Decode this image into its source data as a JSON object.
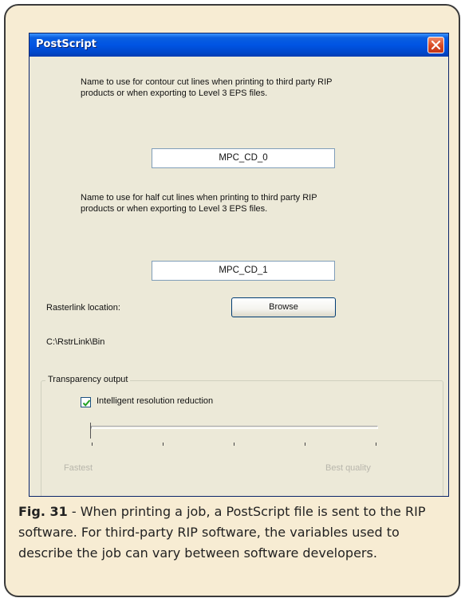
{
  "dialog": {
    "title": "PostScript",
    "contour_description": "Name to use for contour cut lines when printing to third party RIP\nproducts or when exporting to Level 3 EPS files.",
    "contour_name_value": "MPC_CD_0",
    "halfcut_description": "Name to use for half cut lines when printing to third party RIP\nproducts or when exporting to Level 3 EPS files.",
    "halfcut_name_value": "MPC_CD_1",
    "rasterlink_label": "Rasterlink location:",
    "browse_label": "Browse",
    "rasterlink_path": "C:\\RstrLink\\Bin",
    "transparency_group_label": "Transparency output",
    "intelligent_reduction_label": "Intelligent resolution reduction",
    "intelligent_reduction_checked": true,
    "slider_min_label": "Fastest",
    "slider_max_label": "Best quality",
    "slider_value_fraction": 0
  },
  "caption": {
    "figure_label": "Fig. 31",
    "text": " - When printing a job, a PostScript file is sent to the RIP software. For third-party RIP software, the variables used to describe the job can vary between software developers."
  },
  "colors": {
    "frame_background": "#f7ecd3",
    "titlebar_blue": "#0054e3",
    "close_red": "#d84a22"
  }
}
